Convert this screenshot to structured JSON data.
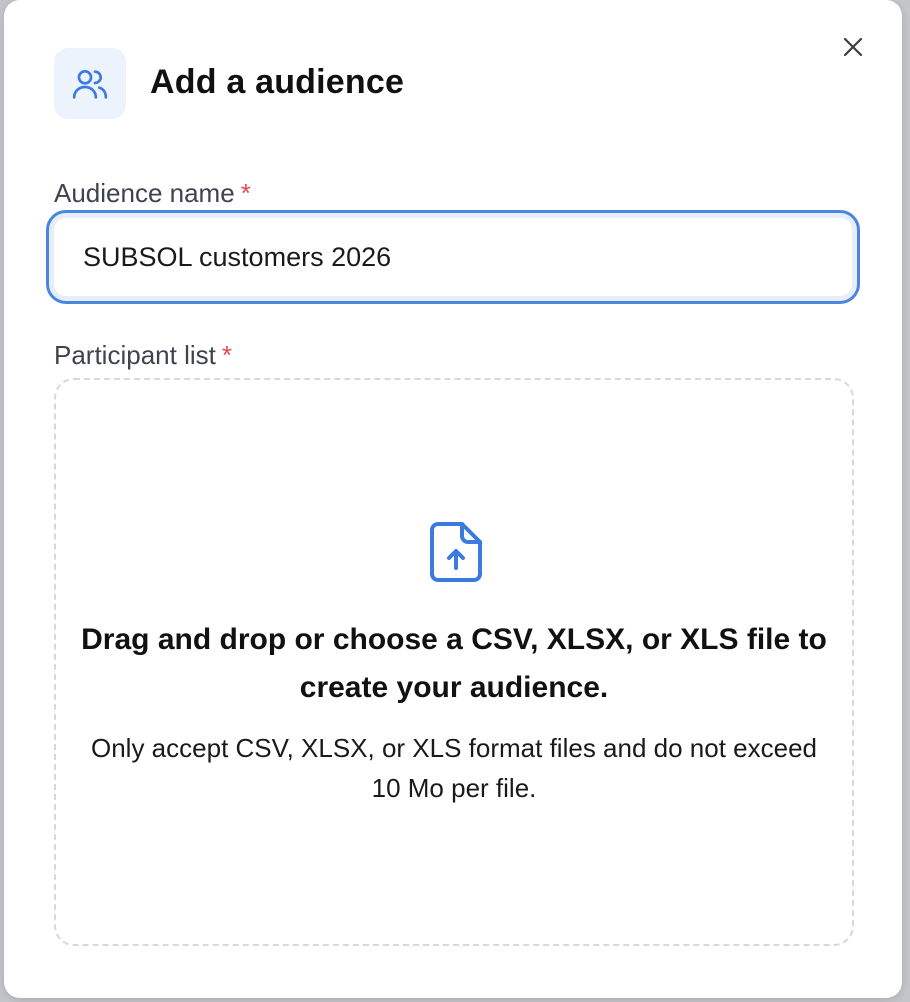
{
  "modal": {
    "title": "Add a audience",
    "header_icon": "users-icon",
    "close_icon": "close-icon"
  },
  "form": {
    "audience_name": {
      "label": "Audience name",
      "required_mark": "*",
      "value": "SUBSOL customers 2026"
    },
    "participant_list": {
      "label": "Participant list",
      "required_mark": "*",
      "dropzone": {
        "icon": "file-upload-icon",
        "title": "Drag and drop or choose a CSV, XLSX, or XLS file to create your audience.",
        "subtitle": "Only accept CSV, XLSX, or XLS format files and do not exceed 10 Mo per file."
      }
    }
  },
  "colors": {
    "accent": "#4a86e0",
    "required": "#e5484d",
    "icon_bg": "#edf3fd"
  }
}
